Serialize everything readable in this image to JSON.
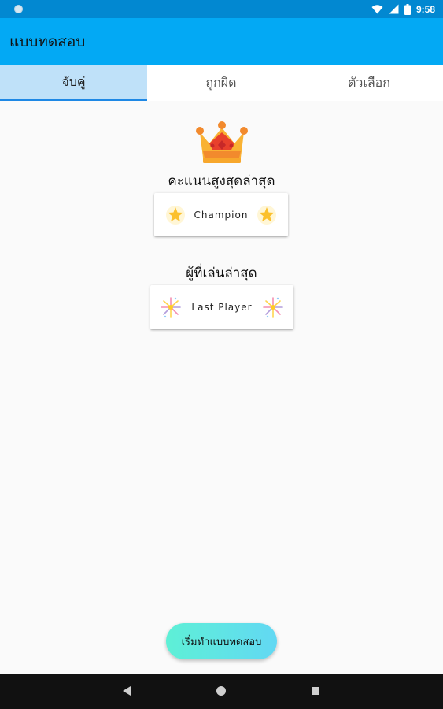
{
  "status_bar": {
    "time": "9:58",
    "icons": [
      "notification-dot-icon",
      "wifi-icon",
      "signal-icon",
      "battery-icon"
    ]
  },
  "app_bar": {
    "title": "แบบทดสอบ",
    "color": "#03a9f4"
  },
  "tabs": [
    {
      "label": "จับคู่",
      "selected": true
    },
    {
      "label": "ถูกผิด",
      "selected": false
    },
    {
      "label": "ตัวเลือก",
      "selected": false
    }
  ],
  "main": {
    "crown_icon": "crown-icon",
    "high_score_title": "คะแนนสูงสุดล่าสุด",
    "high_score_card": {
      "name": "Champion",
      "icon": "star-icon"
    },
    "last_player_title": "ผู้ที่เล่นล่าสุด",
    "last_player_card": {
      "name": "Last Player",
      "icon": "confetti-icon"
    }
  },
  "start_button": {
    "label": "เริ่มทำแบบทดสอบ"
  },
  "nav_bar": {
    "buttons": [
      "back-icon",
      "home-icon",
      "recent-apps-icon"
    ]
  }
}
